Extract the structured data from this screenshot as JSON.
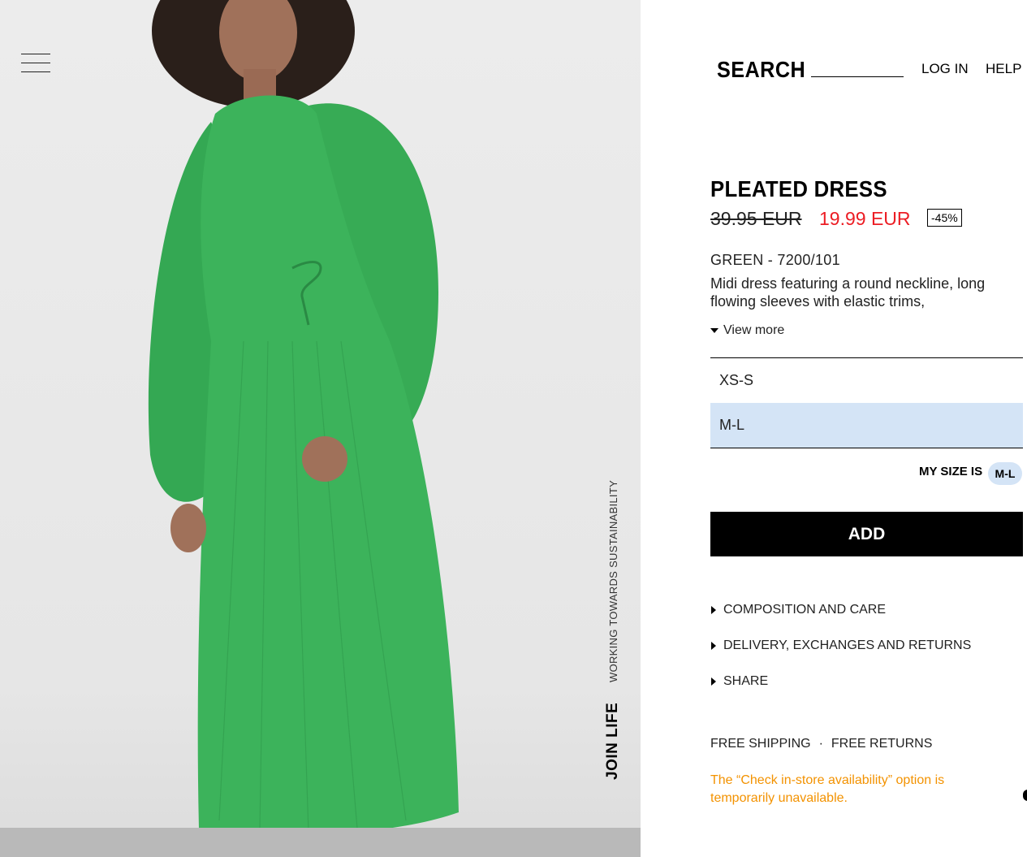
{
  "header": {
    "search_label": "SEARCH",
    "search_value": "",
    "login": "LOG IN",
    "help": "HELP"
  },
  "hero": {
    "join_life": "JOIN LIFE",
    "sustainability": "WORKING TOWARDS SUSTAINABILITY"
  },
  "product": {
    "title": "PLEATED DRESS",
    "old_price": "39.95 EUR",
    "new_price": "19.99 EUR",
    "discount": "-45%",
    "color_ref": "GREEN - 7200/101",
    "description": "Midi dress featuring a round neckline, long flowing sleeves with elastic trims,",
    "view_more": "View more"
  },
  "sizes": {
    "options": [
      "XS-S",
      "M-L"
    ],
    "selected": "M-L",
    "my_size_label": "MY SIZE IS",
    "my_size_value": "M-L"
  },
  "actions": {
    "add": "ADD"
  },
  "accordion": [
    "COMPOSITION AND CARE",
    "DELIVERY, EXCHANGES AND RETURNS",
    "SHARE"
  ],
  "footer": {
    "free_shipping": "FREE SHIPPING",
    "separator": "·",
    "free_returns": "FREE RETURNS",
    "notice": "The “Check in-store availability” option is temporarily unavailable."
  },
  "colors": {
    "sale_price": "#ec1d24",
    "selected_size_bg": "#d4e4f6",
    "notice": "#f39200",
    "dress": "#3aad5a"
  },
  "icons": {
    "menu": "hamburger-icon",
    "expand": "caret-down-icon",
    "accordion": "caret-right-icon"
  }
}
